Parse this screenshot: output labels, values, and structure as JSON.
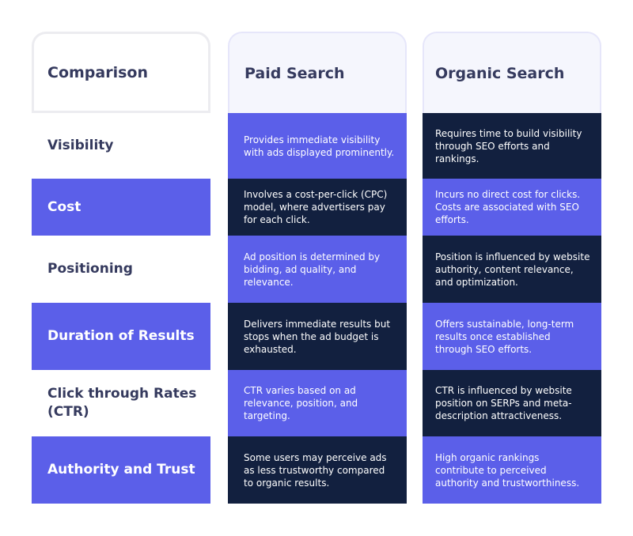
{
  "colors": {
    "accent_purple": "#5b5fe9",
    "navy": "#12203f",
    "heading_text": "#353a5e"
  },
  "columns": {
    "labels_header": "Comparison",
    "paid_header": "Paid Search",
    "organic_header": "Organic Search"
  },
  "rows": [
    {
      "label": "Visibility",
      "paid": "Provides immediate visibility with ads displayed prominently.",
      "organic": "Requires time to build visibility through SEO efforts and rankings."
    },
    {
      "label": "Cost",
      "paid": "Involves a cost-per-click (CPC) model, where advertisers pay for each click.",
      "organic": "Incurs no direct cost for clicks. Costs are associated with SEO efforts."
    },
    {
      "label": "Positioning",
      "paid": "Ad position is determined by bidding, ad quality, and relevance.",
      "organic": "Position is influenced by website authority, content relevance, and optimization."
    },
    {
      "label": "Duration of Results",
      "paid": "Delivers immediate results but stops when the ad budget is exhausted.",
      "organic": "Offers sustainable, long-term results once established through SEO efforts."
    },
    {
      "label": "Click through Rates (CTR)",
      "paid": "CTR varies based on ad relevance, position, and targeting.",
      "organic": "CTR is influenced by website position on SERPs and meta-description attractiveness."
    },
    {
      "label": "Authority and Trust",
      "paid": "Some users may perceive ads as less trustworthy compared to organic results.",
      "organic": "High organic rankings contribute to perceived authority and trustworthiness."
    }
  ]
}
